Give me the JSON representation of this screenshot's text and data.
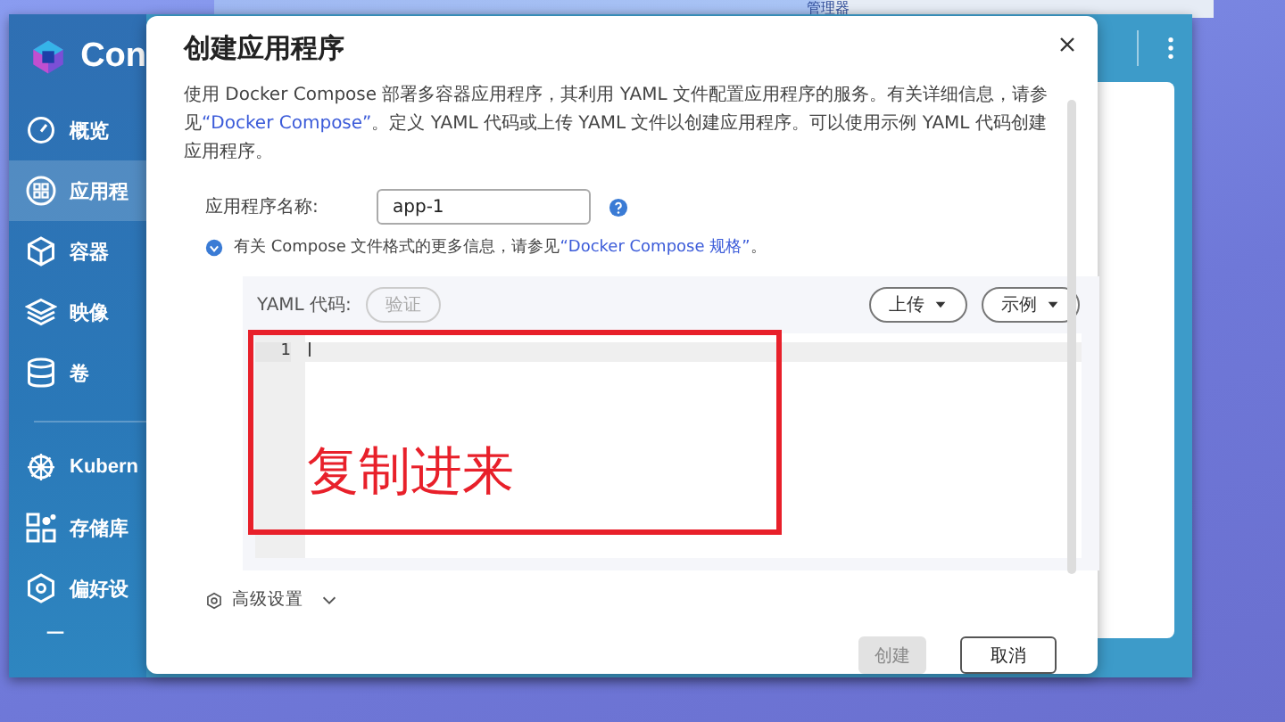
{
  "background_window": {
    "title": "管理器"
  },
  "app": {
    "logo_text": "Con",
    "sidebar": {
      "sections": [
        {
          "items": [
            {
              "label": "概览",
              "selected": false
            },
            {
              "label": "应用程",
              "selected": true
            },
            {
              "label": "容器",
              "selected": false
            },
            {
              "label": "映像",
              "selected": false
            },
            {
              "label": "卷",
              "selected": false
            }
          ]
        },
        {
          "items": [
            {
              "label": "Kubern",
              "selected": false
            },
            {
              "label": "存储库",
              "selected": false
            },
            {
              "label": "偏好设",
              "selected": false
            }
          ]
        }
      ]
    }
  },
  "dialog": {
    "title": "创建应用程序",
    "description": {
      "before": "使用 Docker Compose 部署多容器应用程序，其利用 YAML 文件配置应用程序的服务。有关详细信息，请参见",
      "link": "“Docker Compose”",
      "after": "。定义 YAML 代码或上传 YAML 文件以创建应用程序。可以使用示例 YAML 代码创建应用程序。"
    },
    "name_field": {
      "label": "应用程序名称:",
      "value": "app-1"
    },
    "info": {
      "before": "有关 Compose 文件格式的更多信息，请参见",
      "link": "“Docker Compose 规格”",
      "after": "。"
    },
    "editor": {
      "label": "YAML 代码:",
      "validate_button": {
        "label": "验证",
        "disabled": true
      },
      "menus": [
        {
          "label": "上传"
        },
        {
          "label": "示例"
        }
      ],
      "line_numbers": [
        "1"
      ],
      "annotation": {
        "text": "复制进来"
      }
    },
    "advanced": {
      "label": "高级设置",
      "expanded": false
    },
    "buttons": [
      {
        "label": "创建",
        "kind": "primary",
        "disabled": true
      },
      {
        "label": "取消",
        "kind": "secondary",
        "disabled": false
      }
    ]
  }
}
